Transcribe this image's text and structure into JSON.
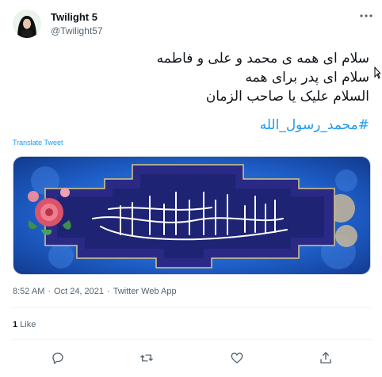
{
  "author": {
    "display_name": "Twilight 5",
    "handle": "@Twilight57",
    "avatar_icon": "avatar-woman-hijab-icon"
  },
  "header": {
    "more_icon": "more-horizontal-icon"
  },
  "tweet": {
    "lines": [
      "سلام ای همه ی محمد و علی و فاطمه",
      "سلام ای پدر برای همه",
      "السلام علیک یا صاحب الزمان"
    ],
    "hashtag": "#محمد_رسول_الله",
    "translate_label": "Translate Tweet"
  },
  "media": {
    "description_icon": "calligraphy-banner-image"
  },
  "meta": {
    "time": "8:52 AM",
    "separator1": "·",
    "date": "Oct 24, 2021",
    "separator2": "·",
    "source": "Twitter Web App"
  },
  "stats": {
    "likes_count": "1",
    "likes_label": "Like"
  },
  "actions": [
    {
      "name": "reply-icon"
    },
    {
      "name": "retweet-icon"
    },
    {
      "name": "like-icon"
    },
    {
      "name": "share-icon"
    }
  ],
  "colors": {
    "link": "#1d9bf0",
    "muted": "#536471",
    "banner_blue": "#1f3fa8",
    "banner_dark": "#1a2470"
  }
}
